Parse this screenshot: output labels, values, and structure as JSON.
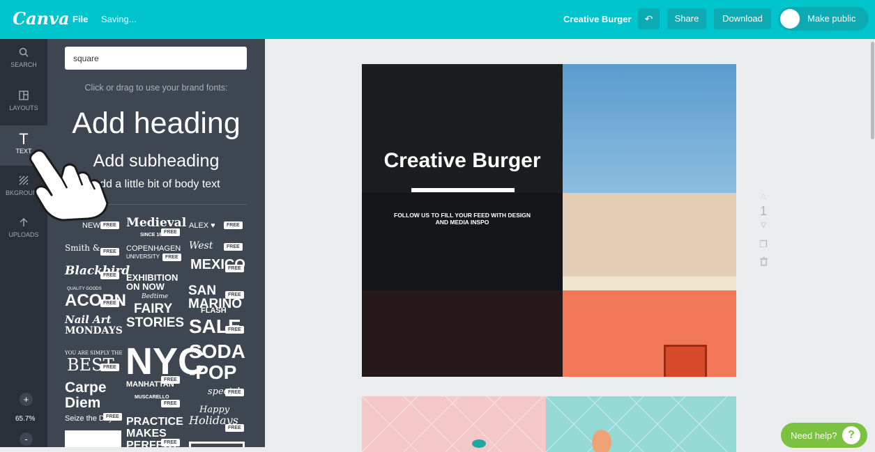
{
  "topbar": {
    "logo": "Canva",
    "file_menu": "File",
    "save_status": "Saving...",
    "design_title": "Creative Burger",
    "undo_icon": "undo-icon",
    "share_label": "Share",
    "download_label": "Download",
    "make_public_label": "Make public",
    "accent_color": "#00c4cc"
  },
  "rail": {
    "items": [
      {
        "label": "SEARCH",
        "icon": "search-icon"
      },
      {
        "label": "LAYOUTS",
        "icon": "layouts-icon"
      },
      {
        "label": "TEXT",
        "icon": "text-icon"
      },
      {
        "label": "BKGROUND",
        "icon": "background-icon"
      },
      {
        "label": "UPLOADS",
        "icon": "upload-icon"
      }
    ],
    "zoom_in": "+",
    "zoom_level": "65.7%",
    "zoom_out": "-"
  },
  "panel": {
    "search_value": "square",
    "brand_hint": "Click or drag to use your brand fonts:",
    "add_heading": "Add heading",
    "add_subheading": "Add subheading",
    "add_body": "Add a little bit of body text",
    "free_badge": "FREE",
    "templates": {
      "t1": "NEW",
      "t2": "Medieval",
      "t2b": "SINCE 1611",
      "t3": "ALEX ♥",
      "t4": "Smith &",
      "t5": "COPENHAGEN",
      "t5b": "UNIVERSITY",
      "t6": "West",
      "t7": "Blackbird",
      "t8": "EXHIBITION",
      "t8b": "ON NOW",
      "t9": "MEXICO",
      "t10": "QUALITY GOODS",
      "t10b": "ACORN",
      "t11": "Bedtime",
      "t11b": "FAIRY",
      "t11c": "STORIES",
      "t12": "SAN MARINO",
      "t13": "Nail Art",
      "t13b": "MONDAYS",
      "t14": "FLASH",
      "t14b": "SALE",
      "t15": "YOU ARE SIMPLY THE",
      "t15b": "BEST",
      "t16": "NYC",
      "t16b": "MANHATTAN",
      "t17": "SODA",
      "t17b": "-POP",
      "t17c": "special",
      "t18": "Carpe",
      "t18b": "Diem",
      "t18c": "Seize the Day",
      "t19": "MUSCARELLO",
      "t20": "Happy",
      "t20b": "Holidays",
      "t21": "PRACTICE",
      "t21b": "MAKES",
      "t21c": "PERFECT"
    }
  },
  "design": {
    "heading": "Creative Burger",
    "subheading": "FOLLOW US TO FILL YOUR FEED WITH DESIGN AND MEDIA INSPO",
    "page_number": "1"
  },
  "help": {
    "label": "Need help?",
    "icon": "?"
  }
}
